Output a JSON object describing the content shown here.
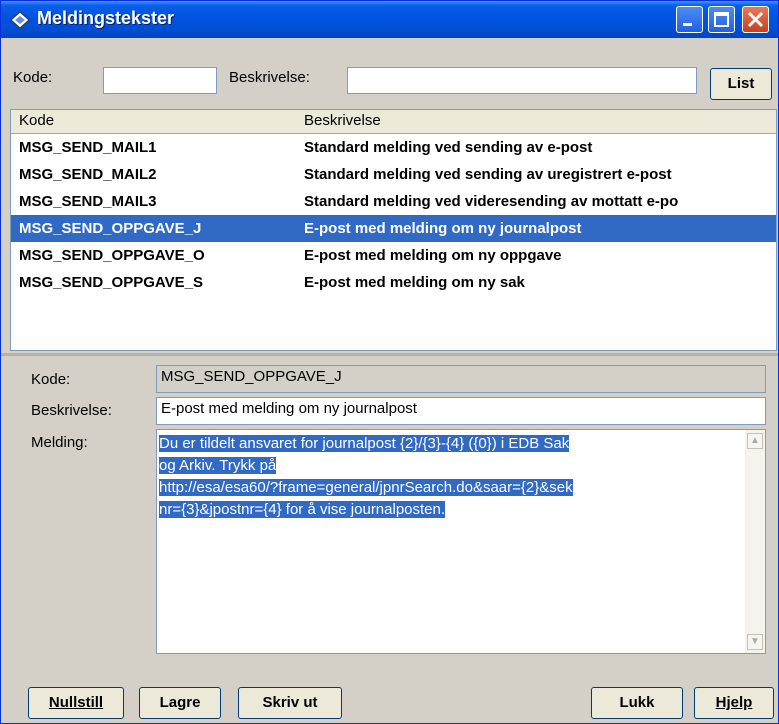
{
  "window": {
    "title": "Meldingstekster"
  },
  "search": {
    "kode_label": "Kode:",
    "kode_value": "",
    "beskrivelse_label": "Beskrivelse:",
    "beskrivelse_value": "",
    "list_button": "List"
  },
  "list": {
    "columns": [
      "Kode",
      "Beskrivelse"
    ],
    "rows": [
      {
        "kode": "MSG_SEND_MAIL1",
        "beskrivelse": "Standard melding ved sending av e-post",
        "selected": false
      },
      {
        "kode": "MSG_SEND_MAIL2",
        "beskrivelse": "Standard melding ved sending av uregistrert e-post",
        "selected": false
      },
      {
        "kode": "MSG_SEND_MAIL3",
        "beskrivelse": "Standard melding ved videresending av mottatt e-po",
        "selected": false
      },
      {
        "kode": "MSG_SEND_OPPGAVE_J",
        "beskrivelse": "E-post med melding om ny journalpost",
        "selected": true
      },
      {
        "kode": "MSG_SEND_OPPGAVE_O",
        "beskrivelse": "E-post med melding om ny oppgave",
        "selected": false
      },
      {
        "kode": "MSG_SEND_OPPGAVE_S",
        "beskrivelse": "E-post med melding om ny sak",
        "selected": false
      }
    ]
  },
  "detail": {
    "kode_label": "Kode:",
    "kode_value": "MSG_SEND_OPPGAVE_J",
    "beskrivelse_label": "Beskrivelse:",
    "beskrivelse_value": "E-post med melding om ny journalpost",
    "melding_label": "Melding:",
    "melding_lines": [
      "Du er tildelt ansvaret for journalpost {2}/{3}-{4} ({0}) i EDB Sak",
      "og Arkiv. Trykk på",
      "http://esa/esa60/?frame=general/jpnrSearch.do&saar={2}&sek",
      "nr={3}&jpostnr={4} for å vise journalposten."
    ]
  },
  "buttons": {
    "nullstill": "Nullstill",
    "lagre": "Lagre",
    "skriv_ut": "Skriv ut",
    "lukk": "Lukk",
    "hjelp": "Hjelp"
  },
  "colors": {
    "selection": "#316ac5",
    "titlebar": "#0054e3",
    "face": "#d4d0c8"
  }
}
